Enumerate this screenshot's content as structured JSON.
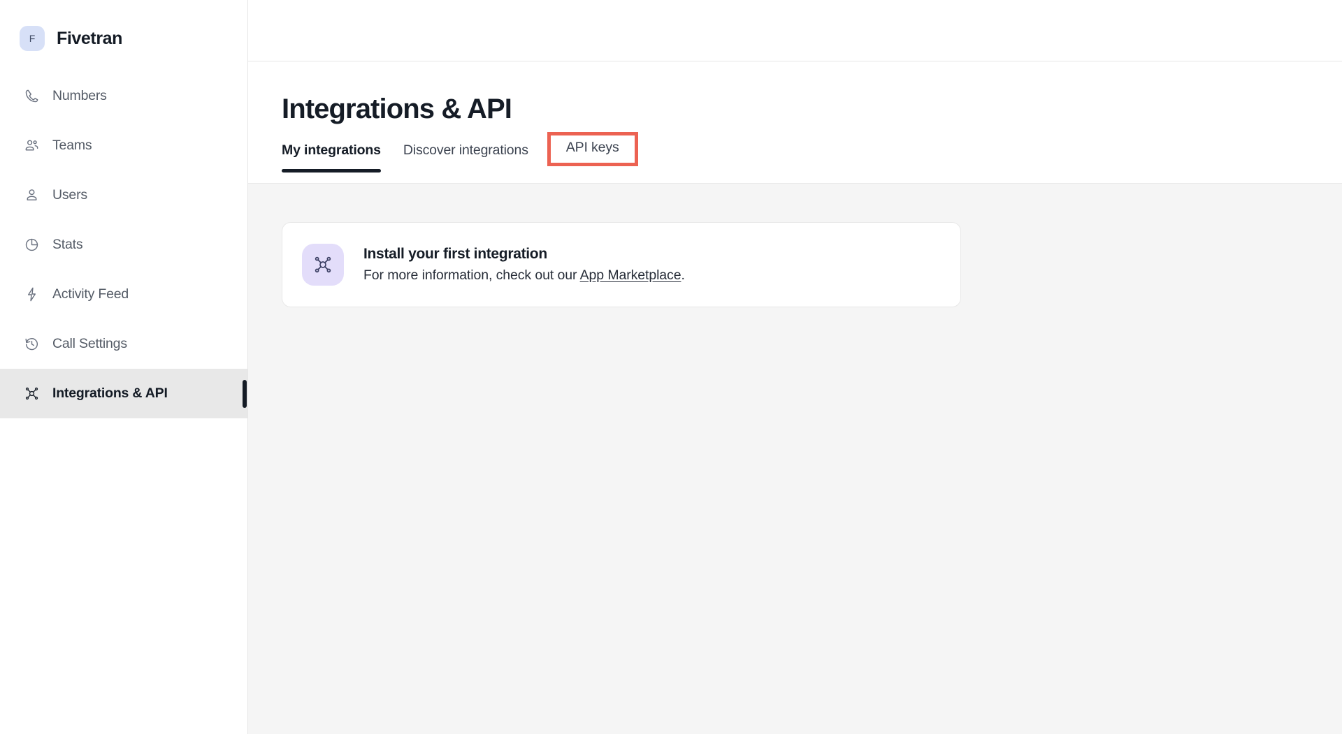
{
  "app": {
    "brand_initial": "F",
    "brand_name": "Fivetran",
    "brand_badge_color": "#d7e0f7"
  },
  "sidebar": {
    "items": [
      {
        "label": "Numbers",
        "icon": "phone-icon",
        "active": false
      },
      {
        "label": "Teams",
        "icon": "people-icon",
        "active": false
      },
      {
        "label": "Users",
        "icon": "user-icon",
        "active": false
      },
      {
        "label": "Stats",
        "icon": "pie-chart-icon",
        "active": false
      },
      {
        "label": "Activity Feed",
        "icon": "lightning-icon",
        "active": false
      },
      {
        "label": "Call Settings",
        "icon": "clock-rewind-icon",
        "active": false
      },
      {
        "label": "Integrations & API",
        "icon": "network-hub-icon",
        "active": true
      }
    ]
  },
  "page": {
    "title": "Integrations & API",
    "tabs": [
      {
        "label": "My integrations",
        "selected": true,
        "highlighted": false
      },
      {
        "label": "Discover integrations",
        "selected": false,
        "highlighted": false
      },
      {
        "label": "API keys",
        "selected": false,
        "highlighted": true
      }
    ],
    "highlight_color": "#ec6252"
  },
  "content": {
    "empty_card": {
      "icon": "network-hub-icon",
      "icon_bg": "#e3ddfa",
      "title": "Install your first integration",
      "subtitle_prefix": "For more information, check out our ",
      "link_label": "App Marketplace",
      "subtitle_suffix": "."
    }
  }
}
